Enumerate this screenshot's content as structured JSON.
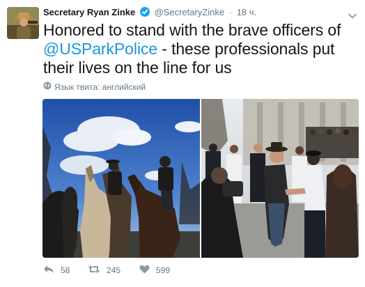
{
  "tweet": {
    "author_name": "Secretary Ryan Zinke",
    "author_handle": "@SecretaryZinke",
    "separator": "·",
    "time": "18 ч.",
    "text_before": "Honored to stand with the brave officers of ",
    "mention": "@USParkPolice",
    "text_after": " - these professionals put their lives on the line for us",
    "language_note": "Язык твита: английский",
    "icons": {
      "verified": "verified-badge-icon",
      "chevron": "chevron-down-icon",
      "globe": "globe-icon",
      "reply": "reply-icon",
      "retweet": "retweet-icon",
      "like": "heart-icon"
    },
    "counts": {
      "reply": "58",
      "retweet": "245",
      "like": "599"
    }
  },
  "colors": {
    "link": "#1b95e0",
    "muted": "#657786",
    "verified": "#1da1f2"
  }
}
